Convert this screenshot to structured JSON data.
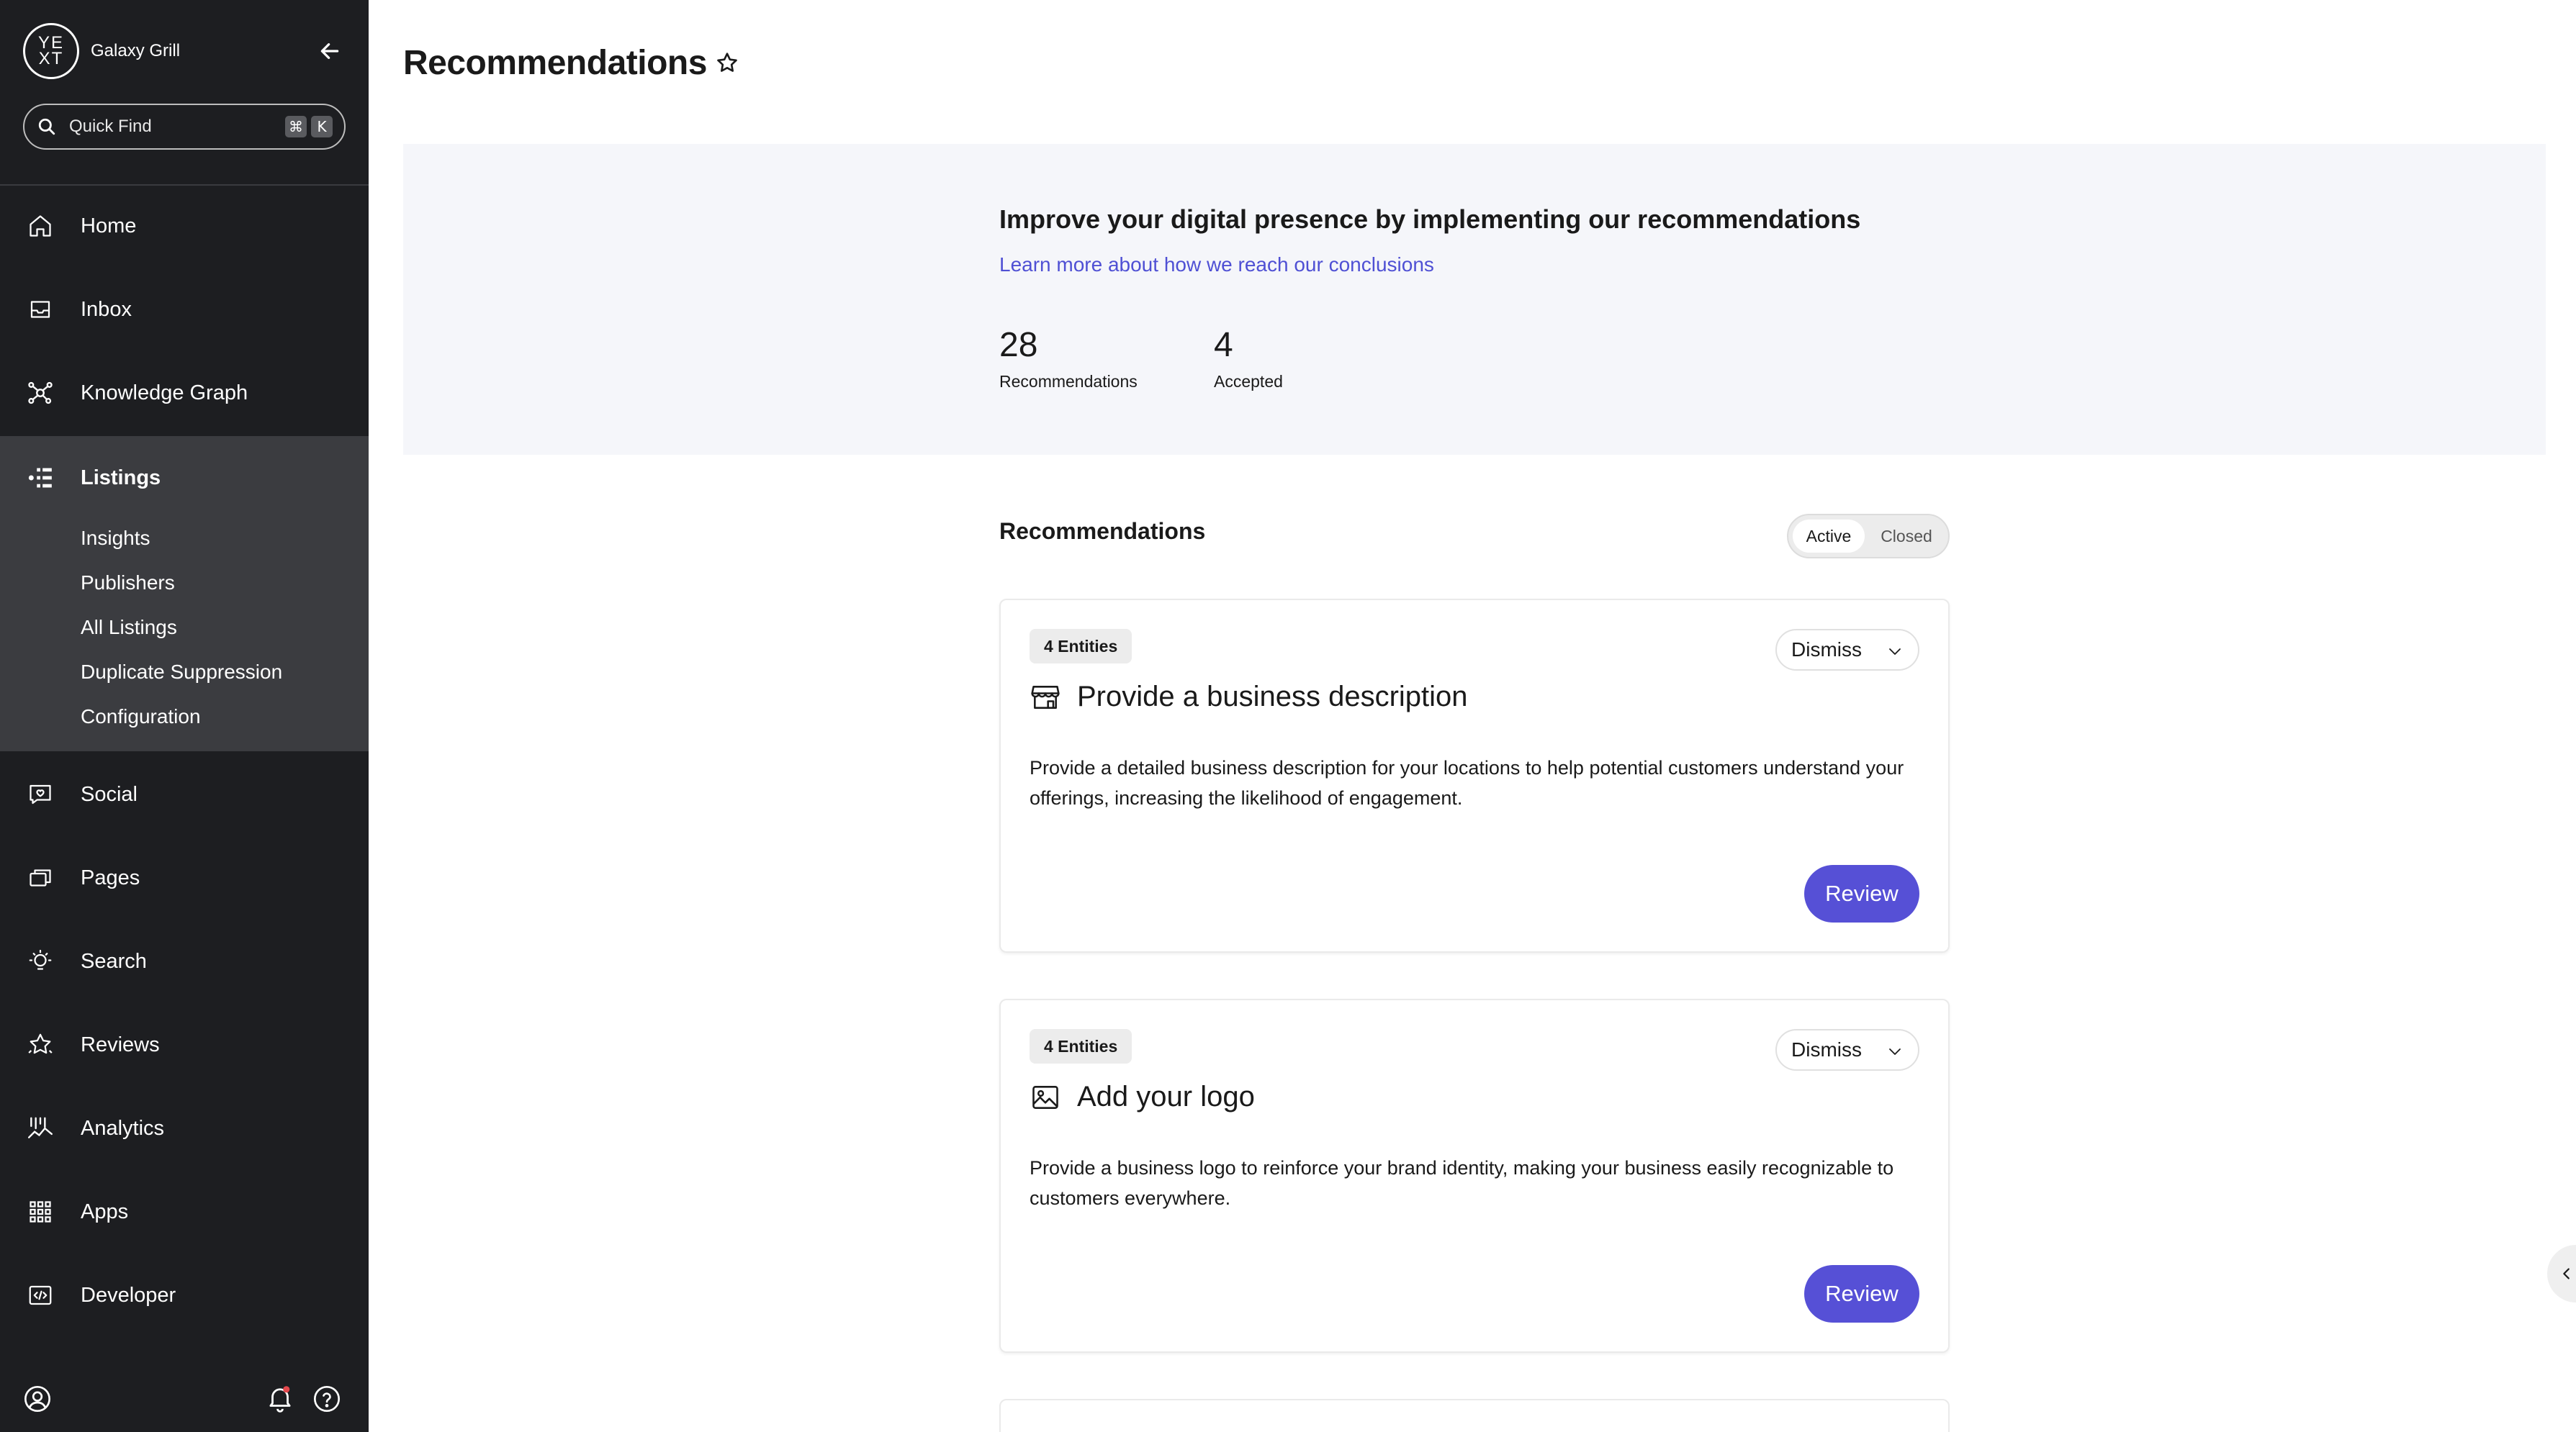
{
  "brand": {
    "logo_text_top": "YE",
    "logo_text_bottom": "XT",
    "account": "Galaxy Grill"
  },
  "quickfind": {
    "label": "Quick Find",
    "key1": "⌘",
    "key2": "K"
  },
  "nav": {
    "home": "Home",
    "inbox": "Inbox",
    "knowledge_graph": "Knowledge Graph",
    "listings": "Listings",
    "listings_sub": [
      "Insights",
      "Publishers",
      "All Listings",
      "Duplicate Suppression",
      "Configuration"
    ],
    "social": "Social",
    "pages": "Pages",
    "search": "Search",
    "reviews": "Reviews",
    "analytics": "Analytics",
    "apps": "Apps",
    "developer": "Developer"
  },
  "page": {
    "title": "Recommendations"
  },
  "hero": {
    "heading": "Improve your digital presence by implementing our recommendations",
    "link": "Learn more about how we reach our conclusions",
    "stats": [
      {
        "value": "28",
        "caption": "Recommendations"
      },
      {
        "value": "4",
        "caption": "Accepted"
      }
    ]
  },
  "section": {
    "title": "Recommendations",
    "toggle": {
      "active": "Active",
      "closed": "Closed"
    }
  },
  "cards": [
    {
      "badge": "4 Entities",
      "dismiss": "Dismiss",
      "icon": "storefront-icon",
      "title": "Provide a business description",
      "description": "Provide a detailed business description for your locations to help potential customers understand your offerings, increasing the likelihood of engagement.",
      "review": "Review"
    },
    {
      "badge": "4 Entities",
      "dismiss": "Dismiss",
      "icon": "image-icon",
      "title": "Add your logo",
      "description": "Provide a business logo to reinforce your brand identity, making your business easily recognizable to customers everywhere.",
      "review": "Review"
    }
  ],
  "colors": {
    "sidebar_bg": "#1d1e21",
    "sidebar_active_bg": "#3b3c40",
    "accent": "#5650d6",
    "link": "#4f50d4",
    "hero_bg": "#f5f6fa"
  }
}
